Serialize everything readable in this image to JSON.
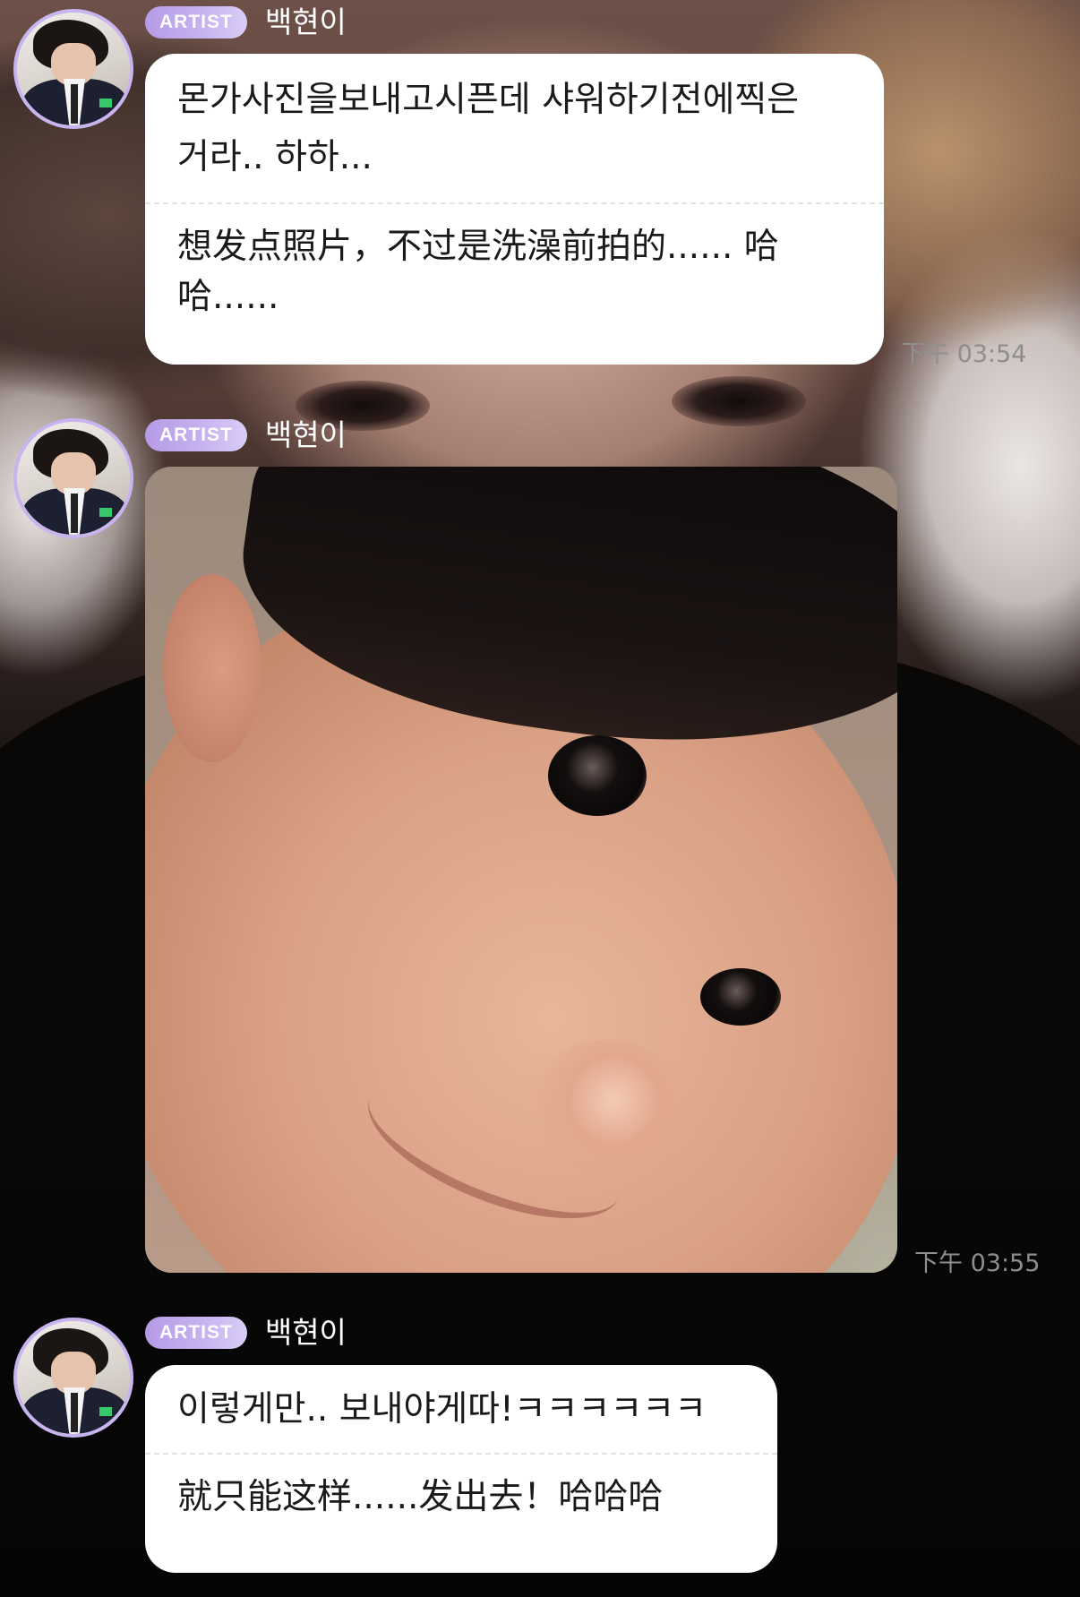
{
  "messages": [
    {
      "badge": "ARTIST",
      "sender": "백현이",
      "text_ko": "몬가사진을보내고시픈데 샤워하기전에찍은\n거라.. 하하...",
      "text_zh": "想发点照片，不过是洗澡前拍的...... 哈\n哈......",
      "time": "下午 03:54"
    },
    {
      "badge": "ARTIST",
      "sender": "백현이",
      "type": "photo",
      "time": "下午 03:55"
    },
    {
      "badge": "ARTIST",
      "sender": "백현이",
      "text_ko": "이렇게만.. 보내야게따!ㅋㅋㅋㅋㅋㅋ",
      "text_zh": "就只能这样......发出去！哈哈哈"
    }
  ],
  "colors": {
    "badge_gradient_start": "#b59be6",
    "avatar_ring": "#c8b4ef",
    "bubble": "#ffffff",
    "timestamp": "#8e8e8e"
  },
  "icons": {
    "avatar": "profile-photo-suit"
  }
}
